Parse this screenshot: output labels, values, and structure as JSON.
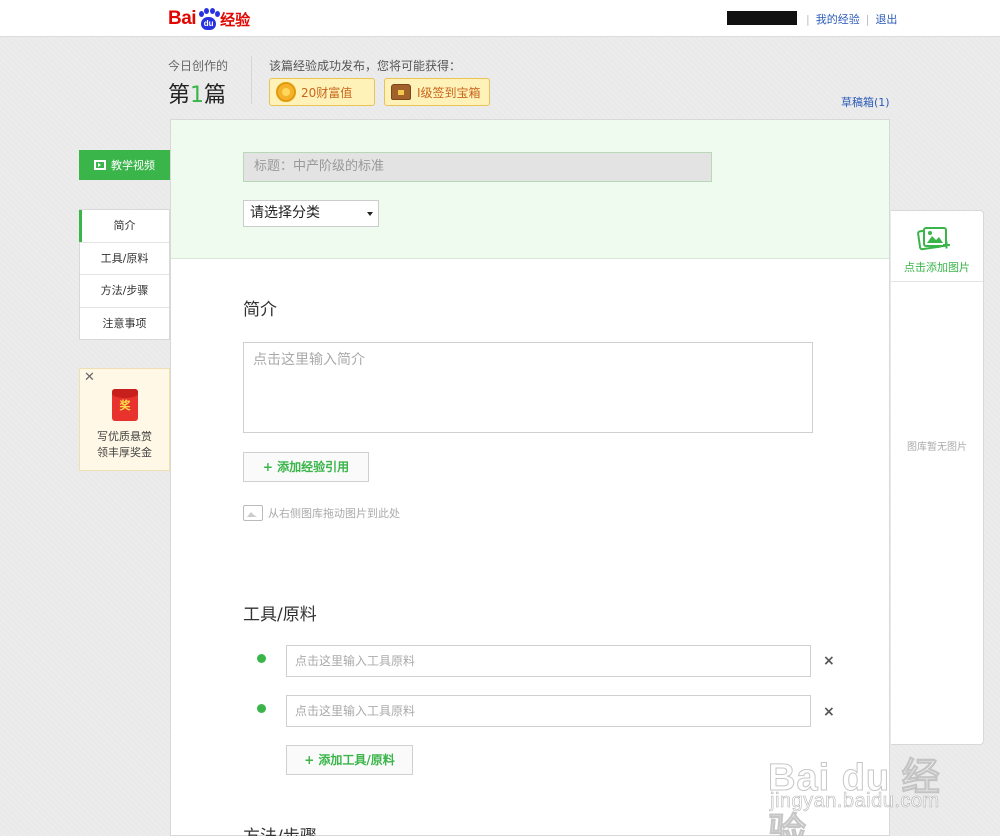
{
  "topbar": {
    "logo_prefix": "Bai",
    "logo_paw_text": "du",
    "logo_suffix": "经验",
    "links": {
      "my_experience": "我的经验",
      "logout": "退出"
    }
  },
  "header": {
    "today_label": "今日创作的",
    "today_prefix": "第",
    "today_count": "1",
    "today_suffix": "篇",
    "reward_label": "该篇经验成功发布，您将可能获得：",
    "rewards": [
      {
        "icon": "coin-icon",
        "label": "20财富值"
      },
      {
        "icon": "treasure-chest-icon",
        "label": "I级签到宝箱"
      }
    ],
    "drafts_link": "草稿箱(1)"
  },
  "form": {
    "title_placeholder": "标题：中产阶级的标准",
    "category_select": "请选择分类",
    "intro": {
      "heading": "简介",
      "placeholder": "点击这里输入简介",
      "add_reference": "+ 添加经验引用",
      "drag_hint": "从右侧图库拖动图片到此处"
    },
    "tools": {
      "heading": "工具/原料",
      "items": [
        {
          "placeholder": "点击这里输入工具原料"
        },
        {
          "placeholder": "点击这里输入工具原料"
        }
      ],
      "remove_glyph": "×",
      "add_button": "+ 添加工具/原料"
    },
    "next_heading": "方法/步骤"
  },
  "sidebar": {
    "video_button": "教学视频",
    "nav": [
      {
        "label": "简介",
        "active": true
      },
      {
        "label": "工具/原料",
        "active": false
      },
      {
        "label": "方法/步骤",
        "active": false
      },
      {
        "label": "注意事项",
        "active": false
      }
    ],
    "promo": {
      "close_glyph": "✕",
      "badge": "奖",
      "line1": "写优质悬赏",
      "line2": "领丰厚奖金"
    }
  },
  "gallery": {
    "add_label": "点击添加图片",
    "empty_label": "图库暂无图片"
  },
  "watermark": {
    "logo": "Bai du 经验",
    "url": "jingyan.baidu.com"
  },
  "colors": {
    "accent_green": "#3ab54a",
    "brand_red": "#e10601",
    "brand_blue": "#2932e1",
    "link_blue": "#2c5bb8",
    "reward_bg": "#fff2b8"
  }
}
